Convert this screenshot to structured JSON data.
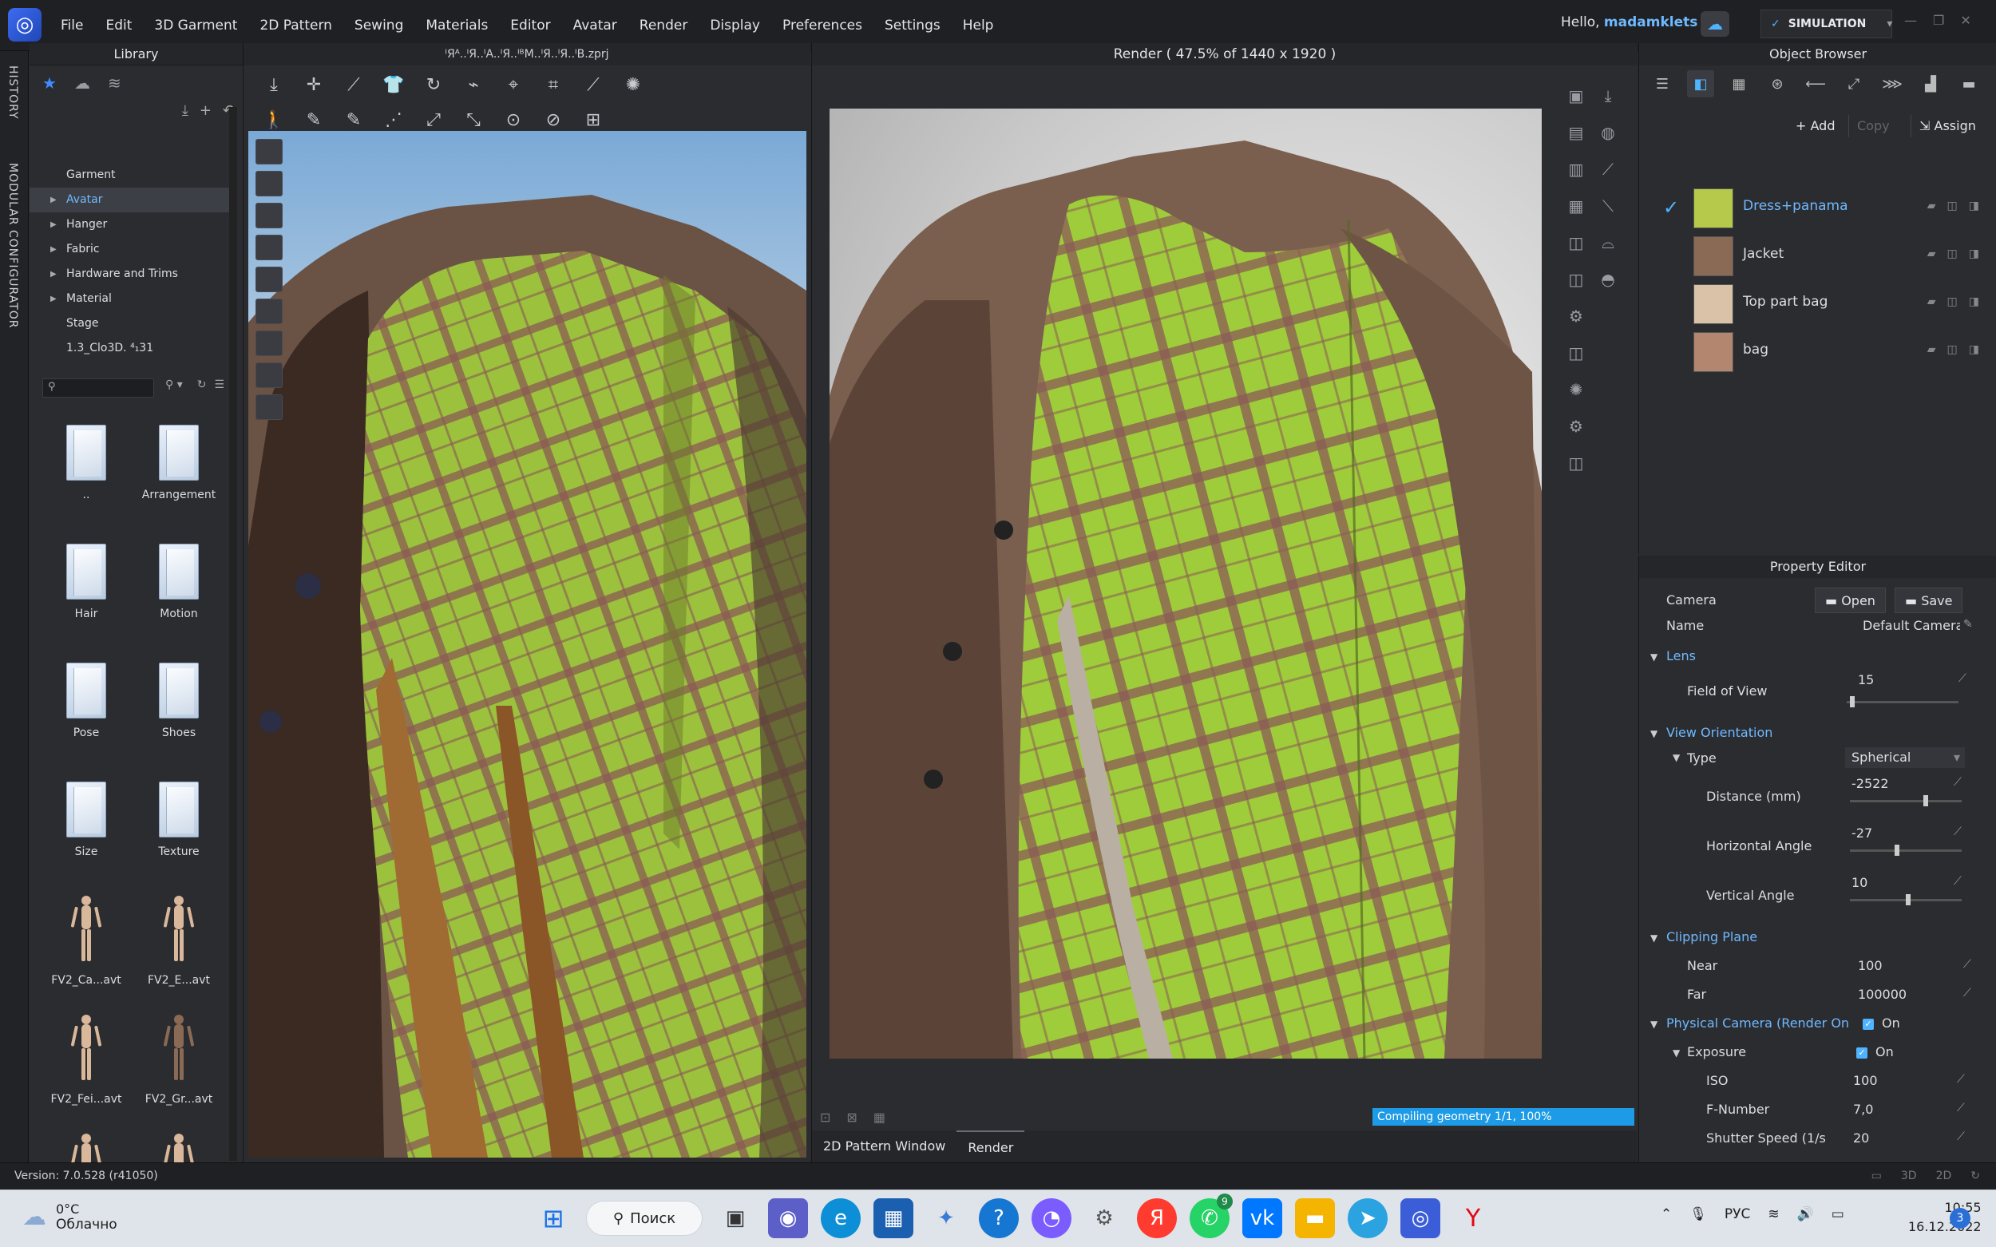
{
  "app": {
    "menus": [
      "File",
      "Edit",
      "3D Garment",
      "2D Pattern",
      "Sewing",
      "Materials",
      "Editor",
      "Avatar",
      "Render",
      "Display",
      "Preferences",
      "Settings",
      "Help"
    ],
    "greeting": "Hello,",
    "user": "madamklets",
    "mode": "SIMULATION",
    "accent": "#3f8bff"
  },
  "side": {
    "history": "HISTORY",
    "modular": "MODULAR CONFIGURATOR"
  },
  "library": {
    "title": "Library",
    "tree": [
      {
        "label": "Garment",
        "arrow": false,
        "selected": false
      },
      {
        "label": "Avatar",
        "arrow": true,
        "selected": true
      },
      {
        "label": "Hanger",
        "arrow": true,
        "selected": false
      },
      {
        "label": "Fabric",
        "arrow": true,
        "selected": false
      },
      {
        "label": "Hardware and Trims",
        "arrow": true,
        "selected": false
      },
      {
        "label": "Material",
        "arrow": true,
        "selected": false
      },
      {
        "label": "Stage",
        "arrow": false,
        "selected": false
      },
      {
        "label": "1.3_Clo3D. ⁴₁31",
        "arrow": false,
        "selected": false
      }
    ],
    "items": [
      {
        "label": "..",
        "kind": "folder"
      },
      {
        "label": "Arrangement",
        "kind": "folder"
      },
      {
        "label": "Hair",
        "kind": "folder"
      },
      {
        "label": "Motion",
        "kind": "folder"
      },
      {
        "label": "Pose",
        "kind": "folder"
      },
      {
        "label": "Shoes",
        "kind": "folder"
      },
      {
        "label": "Size",
        "kind": "folder"
      },
      {
        "label": "Texture",
        "kind": "folder"
      },
      {
        "label": "FV2_Ca...avt",
        "kind": "avatar"
      },
      {
        "label": "FV2_E...avt",
        "kind": "avatar"
      },
      {
        "label": "FV2_Fei...avt",
        "kind": "avatar"
      },
      {
        "label": "FV2_Gr...avt",
        "kind": "avatar"
      },
      {
        "label": "",
        "kind": "avatar"
      },
      {
        "label": "",
        "kind": "avatar"
      }
    ]
  },
  "viewport3d": {
    "title": "ᴵЯᴬ..ᴵЯ..ᴵA..ᴵЯ..ᴵᴮM..ᴵЯ..ᴵЯ..ᴵB.zprj"
  },
  "render": {
    "title": "Render ( 47.5% of 1440 x 1920 )",
    "progress": "Compiling geometry 1/1, 100%",
    "tabs": [
      "2D Pattern Window",
      "Render"
    ]
  },
  "objectBrowser": {
    "title": "Object Browser",
    "add": "+ Add",
    "copy": "Copy",
    "assign": "Assign",
    "items": [
      {
        "name": "Dress+panama",
        "active": true,
        "swatch": "#b6c94a"
      },
      {
        "name": "Jacket",
        "active": false,
        "swatch": "#8a6a55"
      },
      {
        "name": "Top part bag",
        "active": false,
        "swatch": "#d9c2a8"
      },
      {
        "name": "bag",
        "active": false,
        "swatch": "#b38670"
      }
    ]
  },
  "property": {
    "title": "Property Editor",
    "camera": "Camera",
    "open": "Open",
    "save": "Save",
    "nameLabel": "Name",
    "nameValue": "Default Camera",
    "lens": "Lens",
    "fov": "Field of View",
    "fovValue": "15",
    "viewOrientation": "View Orientation",
    "type": "Type",
    "typeValue": "Spherical",
    "distance": "Distance (mm)",
    "distanceValue": "-2522",
    "hAngle": "Horizontal Angle",
    "hAngleValue": "-27",
    "vAngle": "Vertical Angle",
    "vAngleValue": "10",
    "clipping": "Clipping Plane",
    "near": "Near",
    "nearValue": "100",
    "far": "Far",
    "farValue": "100000",
    "physCam": "Physical Camera (Render Onl",
    "physOn": "On",
    "exposure": "Exposure",
    "expOn": "On",
    "iso": "ISO",
    "isoValue": "100",
    "fnum": "F-Number",
    "fnumValue": "7,0",
    "shutter": "Shutter Speed (1/s",
    "shutterValue": "20"
  },
  "status": {
    "version": "Version: 7.0.528 (r41050)"
  },
  "taskbar": {
    "temp": "0°C",
    "weather": "Облачно",
    "search": "Поиск",
    "lang": "РУС",
    "time": "10:55",
    "date": "16.12.2022",
    "notif": "3",
    "whatsappBadge": "9"
  }
}
